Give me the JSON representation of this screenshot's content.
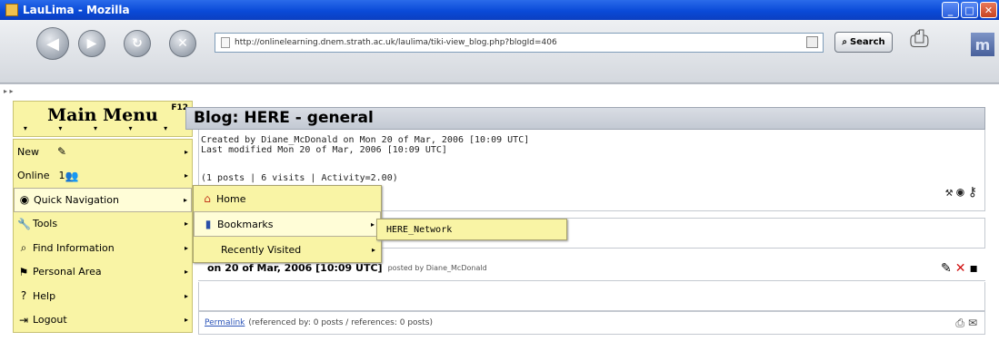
{
  "window": {
    "title": "LauLima - Mozilla",
    "minimize": "_",
    "maximize": "□",
    "close": "✕"
  },
  "navbar": {
    "url": "http://onlinelearning.dnem.strath.ac.uk/laulima/tiki-view_blog.php?blogId=406",
    "search_label": "Search",
    "mini_arrows": "▸ ▸"
  },
  "main_menu": {
    "title": "Main Menu",
    "shortcut": "F12",
    "arrows": "▾ ▾ ▾ ▾ ▾",
    "items": [
      {
        "label": "New",
        "icon": "new-icon",
        "glyph": "✎"
      },
      {
        "label": "Online",
        "count": "1",
        "icon": "users-icon",
        "glyph": "👥"
      },
      {
        "label": "Quick Navigation",
        "icon": "globe-icon",
        "glyph": "◉"
      },
      {
        "label": "Tools",
        "icon": "tools-icon",
        "glyph": "🔧"
      },
      {
        "label": "Find Information",
        "icon": "find-icon",
        "glyph": "⌕"
      },
      {
        "label": "Personal Area",
        "icon": "personal-icon",
        "glyph": "⚑"
      },
      {
        "label": "Help",
        "icon": "help-icon",
        "glyph": "?"
      },
      {
        "label": "Logout",
        "icon": "logout-icon",
        "glyph": "⇥"
      }
    ]
  },
  "quick_nav": {
    "items": [
      {
        "label": "Home",
        "icon": "home-icon",
        "glyph": "⌂"
      },
      {
        "label": "Bookmarks",
        "icon": "bookmarks-icon",
        "glyph": "▮"
      },
      {
        "label": "Recently Visited"
      }
    ]
  },
  "bookmarks_submenu": {
    "item": "HERE_Network"
  },
  "blog": {
    "title": "Blog: HERE - general",
    "created": "Created by Diane_McDonald on Mon 20 of Mar, 2006 [10:09 UTC]",
    "modified": "Last modified Mon 20 of Mar, 2006 [10:09 UTC]",
    "stats": "(1 posts | 6 visits | Activity=2.00)"
  },
  "post": {
    "date": "on 20 of Mar, 2006 [10:09 UTC]",
    "posted_by": "posted by Diane_McDonald",
    "permalink": "Permalink",
    "references": "(referenced by: 0 posts / references: 0 posts)"
  },
  "footer": {
    "text": "Mon 20 of Mar, 2006"
  }
}
